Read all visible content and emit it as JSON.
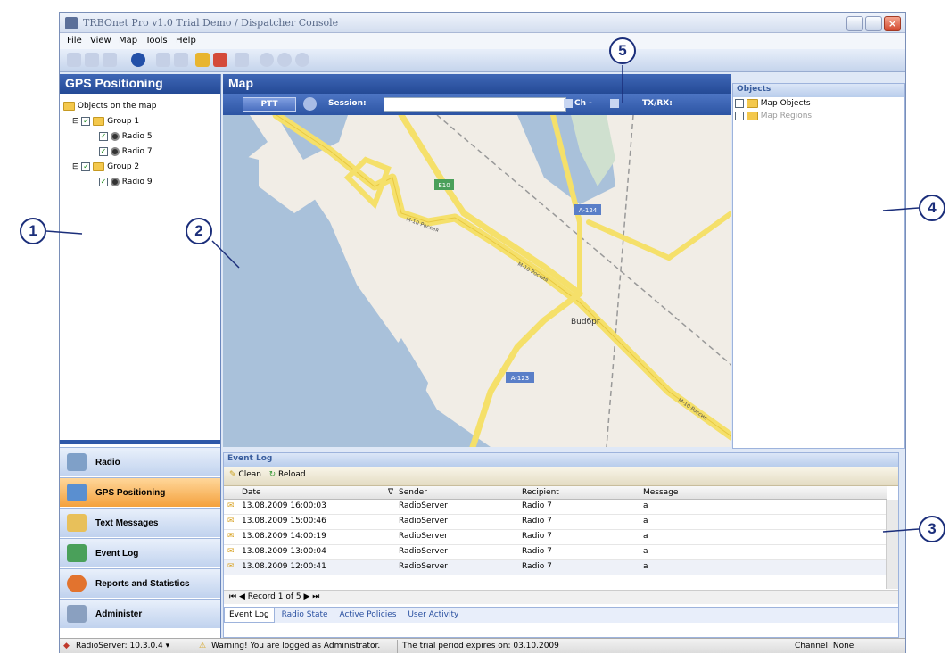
{
  "window": {
    "title": "TRBOnet Pro v1.0 Trial Demo / Dispatcher Console"
  },
  "menu": {
    "file": "File",
    "view": "View",
    "map": "Map",
    "tools": "Tools",
    "help": "Help"
  },
  "left_panel": {
    "title": "GPS Positioning",
    "tree": {
      "root": "Objects on the map",
      "group1": "Group 1",
      "radio5": "Radio 5",
      "radio7": "Radio 7",
      "group2": "Group 2",
      "radio9": "Radio 9"
    }
  },
  "nav": {
    "radio": "Radio",
    "gps": "GPS Positioning",
    "text": "Text Messages",
    "eventlog": "Event Log",
    "reports": "Reports and Statistics",
    "administer": "Administer"
  },
  "map": {
    "title": "Map",
    "ptt": "PTT",
    "session_label": "Session:",
    "session_value": "",
    "ch_label": "Ch -",
    "txrx_label": "TX/RX:",
    "labels": {
      "e10": "E10",
      "a124": "A-124",
      "a123": "A-123",
      "city": "Budбpr",
      "road1": "M-10 Россия",
      "road2": "M-10 Россия",
      "road3": "M-10 Россия"
    }
  },
  "objects": {
    "title": "Objects",
    "map_objects": "Map Objects",
    "map_regions": "Map Regions"
  },
  "event_log": {
    "title": "Event Log",
    "clean": "Clean",
    "reload": "Reload",
    "columns": {
      "date": "Date",
      "sender": "Sender",
      "recipient": "Recipient",
      "message": "Message"
    },
    "rows": [
      {
        "date": "13.08.2009 16:00:03",
        "sender": "RadioServer",
        "recipient": "Radio 7",
        "message": "a"
      },
      {
        "date": "13.08.2009 15:00:46",
        "sender": "RadioServer",
        "recipient": "Radio 7",
        "message": "a"
      },
      {
        "date": "13.08.2009 14:00:19",
        "sender": "RadioServer",
        "recipient": "Radio 7",
        "message": "a"
      },
      {
        "date": "13.08.2009 13:00:04",
        "sender": "RadioServer",
        "recipient": "Radio 7",
        "message": "a"
      },
      {
        "date": "13.08.2009 12:00:41",
        "sender": "RadioServer",
        "recipient": "Radio 7",
        "message": "a"
      }
    ],
    "pager": "Record 1 of 5",
    "tabs": [
      "Event Log",
      "Radio State",
      "Active Policies",
      "User Activity"
    ]
  },
  "status": {
    "server": "RadioServer: 10.3.0.4 ▾",
    "warning": "Warning! You are logged as Administrator.",
    "trial": "The trial period expires on: 03.10.2009",
    "channel": "Channel: None"
  },
  "callouts": {
    "c1": "1",
    "c2": "2",
    "c3": "3",
    "c4": "4",
    "c5": "5"
  }
}
